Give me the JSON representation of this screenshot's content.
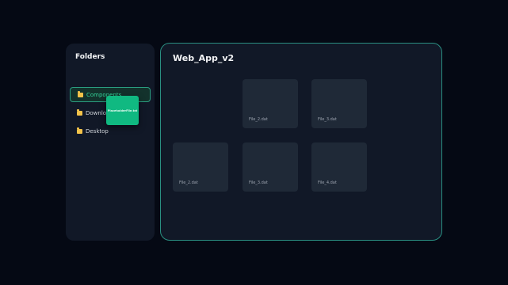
{
  "sidebar": {
    "title": "Folders",
    "items": [
      {
        "label": "Components",
        "active": true
      },
      {
        "label": "Downloads",
        "active": false
      },
      {
        "label": "Desktop",
        "active": false
      }
    ]
  },
  "drag": {
    "file_label": "PlaceholderFile.txt"
  },
  "main": {
    "title": "Web_App_v2",
    "files": [
      {
        "label": "File_2.dat"
      },
      {
        "label": "File_3.dat"
      },
      {
        "label": "File_2.dat"
      },
      {
        "label": "File_3.dat"
      },
      {
        "label": "File_4.dat"
      }
    ]
  },
  "colors": {
    "accent": "#10b981",
    "border_accent": "#2a8f82",
    "folder": "#f4c34a",
    "background": "#050914",
    "panel": "#111827",
    "tile": "#1f2937"
  }
}
